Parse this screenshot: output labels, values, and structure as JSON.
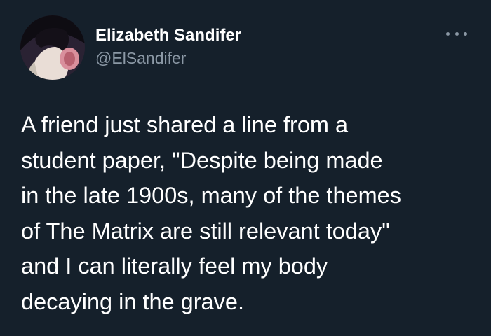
{
  "tweet": {
    "author": {
      "display_name": "Elizabeth Sandifer",
      "handle": "@ElSandifer"
    },
    "more_icon": "more-horizontal-icon",
    "text_lines": [
      "A friend just shared a line from a",
      "student paper, \"Despite being made",
      "in the late 1900s, many of the themes",
      "of The Matrix are still relevant today\"",
      "and I can literally feel my body",
      "decaying in the grave."
    ]
  },
  "colors": {
    "background": "#15202b",
    "primary_text": "#ffffff",
    "secondary_text": "#8b98a5"
  }
}
